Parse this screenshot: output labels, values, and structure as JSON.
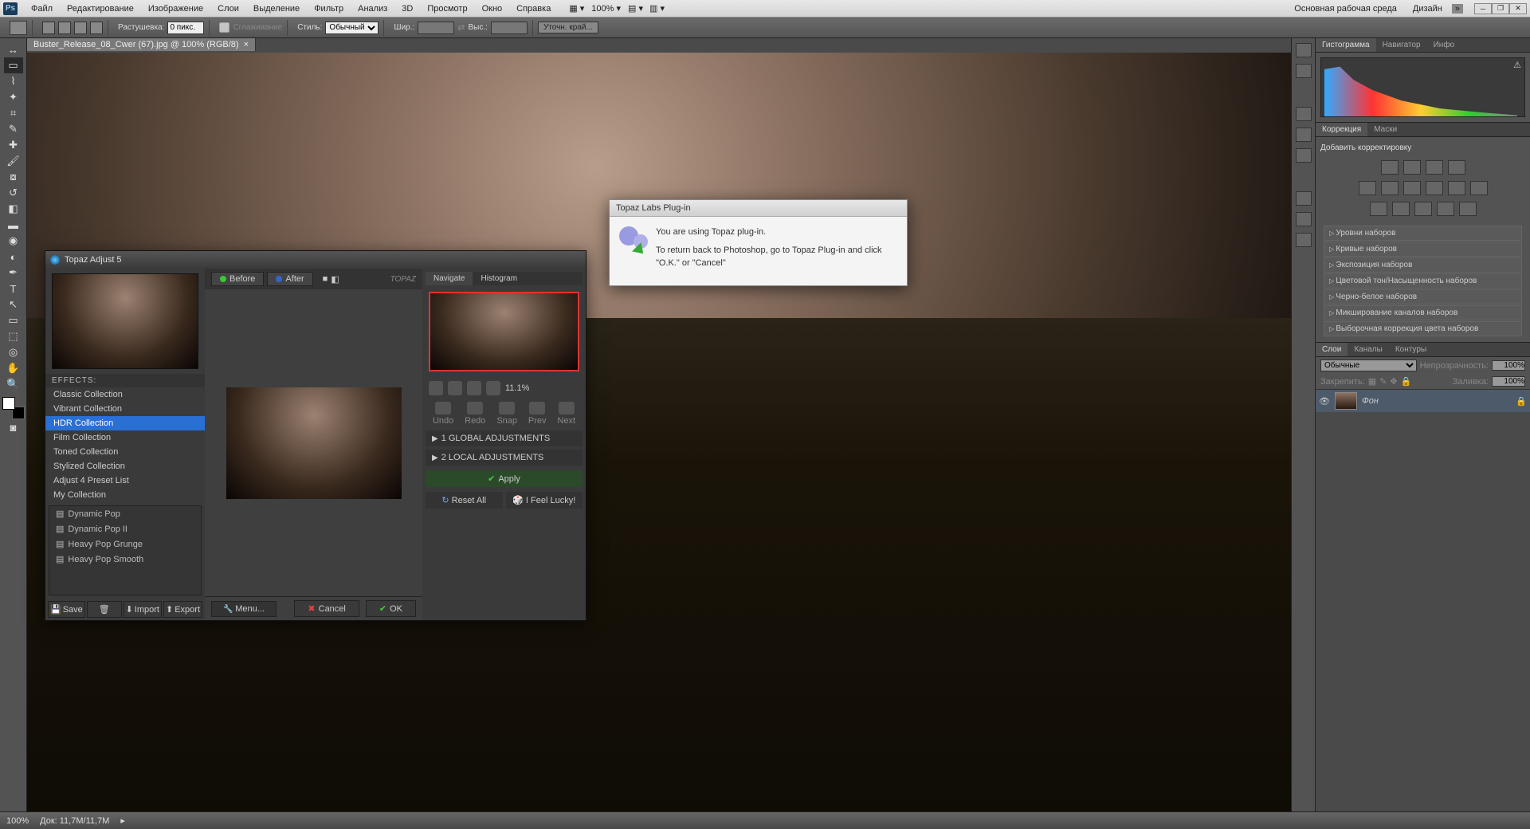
{
  "menubar": {
    "items": [
      "Файл",
      "Редактирование",
      "Изображение",
      "Слои",
      "Выделение",
      "Фильтр",
      "Анализ",
      "3D",
      "Просмотр",
      "Окно",
      "Справка"
    ],
    "zoom_dropdown": "100%",
    "workspace_main": "Основная рабочая среда",
    "workspace_design": "Дизайн"
  },
  "optbar": {
    "feather_label": "Растушевка:",
    "feather_value": "0 пикс.",
    "antialias_label": "Сглаживание",
    "style_label": "Стиль:",
    "style_value": "Обычный",
    "width_label": "Шир.:",
    "height_label": "Выс.:",
    "refine_btn": "Уточн. край..."
  },
  "doc": {
    "tab_title": "Buster_Release_08_Cwer (67).jpg @ 100% (RGB/8)"
  },
  "topaz": {
    "title": "Topaz Adjust 5",
    "before": "Before",
    "after": "After",
    "logo": "TOPAZ",
    "effects_header": "EFFECTS:",
    "collections": [
      "Classic Collection",
      "Vibrant Collection",
      "HDR Collection",
      "Film Collection",
      "Toned Collection",
      "Stylized Collection",
      "Adjust 4 Preset List",
      "My Collection"
    ],
    "collections_selected": 2,
    "presets": [
      "Dynamic Pop",
      "Dynamic Pop II",
      "Heavy Pop Grunge",
      "Heavy Pop Smooth"
    ],
    "save": "Save",
    "delete": "",
    "import": "Import",
    "export": "Export",
    "menu": "Menu...",
    "cancel": "Cancel",
    "ok": "OK",
    "nav_tab": "Navigate",
    "hist_tab": "Histogram",
    "zoom_pct": "11.1%",
    "undo": "Undo",
    "redo": "Redo",
    "snap": "Snap",
    "prev": "Prev",
    "next": "Next",
    "global_adj": "1 GLOBAL ADJUSTMENTS",
    "local_adj": "2 LOCAL ADJUSTMENTS",
    "apply": "Apply",
    "reset_all": "Reset All",
    "feel_lucky": "I Feel Lucky!"
  },
  "msg": {
    "title": "Topaz Labs Plug-in",
    "line1": "You are using Topaz plug-in.",
    "line2": "To return back to Photoshop, go to Topaz Plug-in and click \"O.K.\" or \"Cancel\""
  },
  "panels": {
    "hist_tabs": [
      "Гистограмма",
      "Навигатор",
      "Инфо"
    ],
    "corr_tabs": [
      "Коррекция",
      "Маски"
    ],
    "corr_heading": "Добавить корректировку",
    "corr_presets": [
      "Уровни наборов",
      "Кривые наборов",
      "Экспозиция наборов",
      "Цветовой тон/Насыщенность наборов",
      "Черно-белое наборов",
      "Микширование каналов наборов",
      "Выборочная коррекция цвета наборов"
    ],
    "layer_tabs": [
      "Слои",
      "Каналы",
      "Контуры"
    ],
    "blend_mode": "Обычные",
    "opacity_label": "Непрозрачность:",
    "opacity_val": "100%",
    "lock_label": "Закрепить:",
    "fill_label": "Заливка:",
    "fill_val": "100%",
    "layer_name": "Фон"
  },
  "status": {
    "zoom": "100%",
    "docsize": "Док: 11,7M/11,7M"
  }
}
